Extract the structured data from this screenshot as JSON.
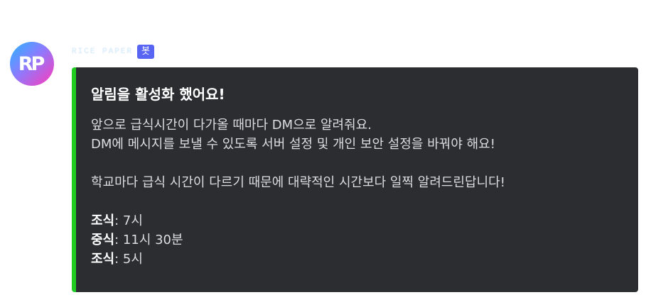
{
  "avatar": {
    "initials": "RP"
  },
  "author": {
    "name": "RICE PAPER",
    "tag": "봇"
  },
  "embed": {
    "accent_color": "#20cc20",
    "title": "알림을 활성화 했어요!",
    "lines": [
      "앞으로 급식시간이 다가올 때마다 DM으로 알려줘요.",
      "DM에 메시지를 보낼 수 있도록 서버 설정 및 개인 보안 설정을 바꿔야 해요!",
      "학교마다 급식 시간이 다르기 때문에 대략적인 시간보다 일찍 알려드린답니다!"
    ],
    "meals": [
      {
        "label": "조식",
        "sep": ": ",
        "time": "7시"
      },
      {
        "label": "중식",
        "sep": ": ",
        "time": "11시 30분"
      },
      {
        "label": "조식",
        "sep": ": ",
        "time": "5시"
      }
    ]
  }
}
